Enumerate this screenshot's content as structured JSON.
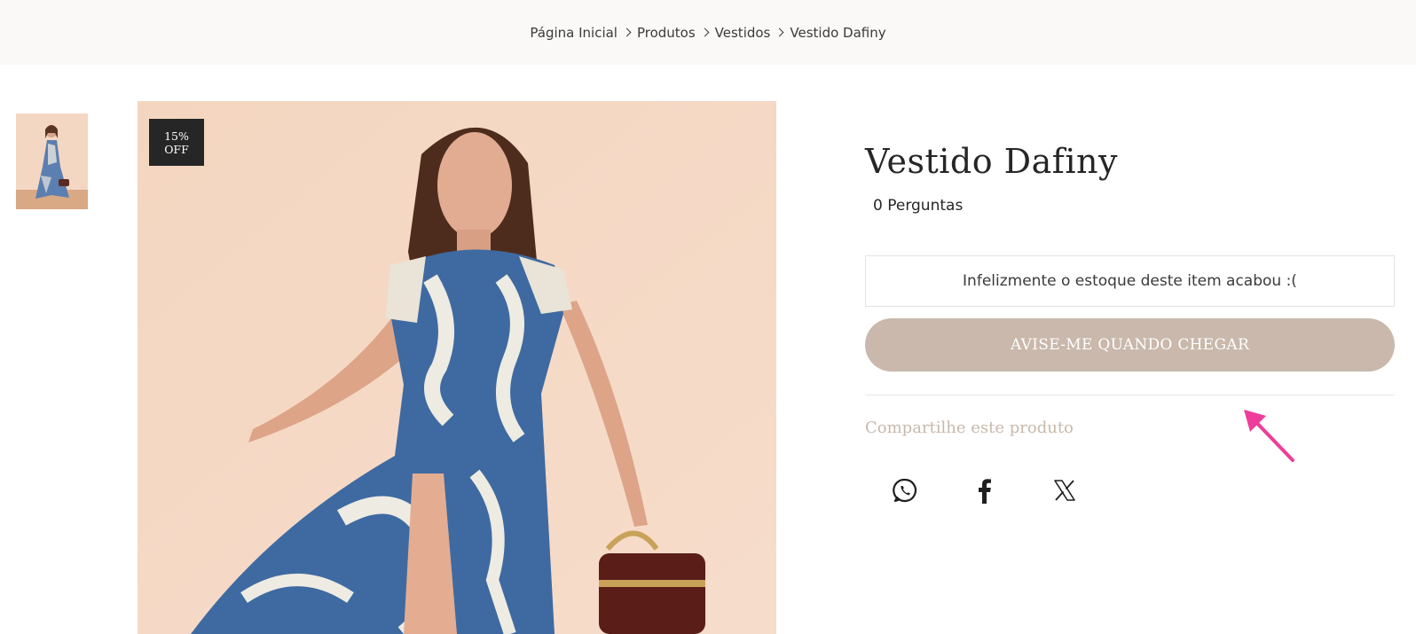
{
  "breadcrumb": {
    "items": [
      "Página Inicial",
      "Produtos",
      "Vestidos",
      "Vestido Dafiny"
    ]
  },
  "badge": {
    "line1": "15%",
    "line2": "OFF"
  },
  "product": {
    "title": "Vestido Dafiny",
    "questions": "0 Perguntas",
    "stock_message": "Infelizmente o estoque deste item acabou :(",
    "notify_button": "AVISE-ME QUANDO CHEGAR"
  },
  "share": {
    "title": "Compartilhe este produto",
    "icons": [
      "whatsapp-icon",
      "facebook-icon",
      "x-icon"
    ]
  },
  "colors": {
    "accent": "#c9b8ab",
    "badge_bg": "#262626",
    "breadcrumb_bg": "#faf9f7",
    "annotation_arrow": "#ee3d9a"
  }
}
